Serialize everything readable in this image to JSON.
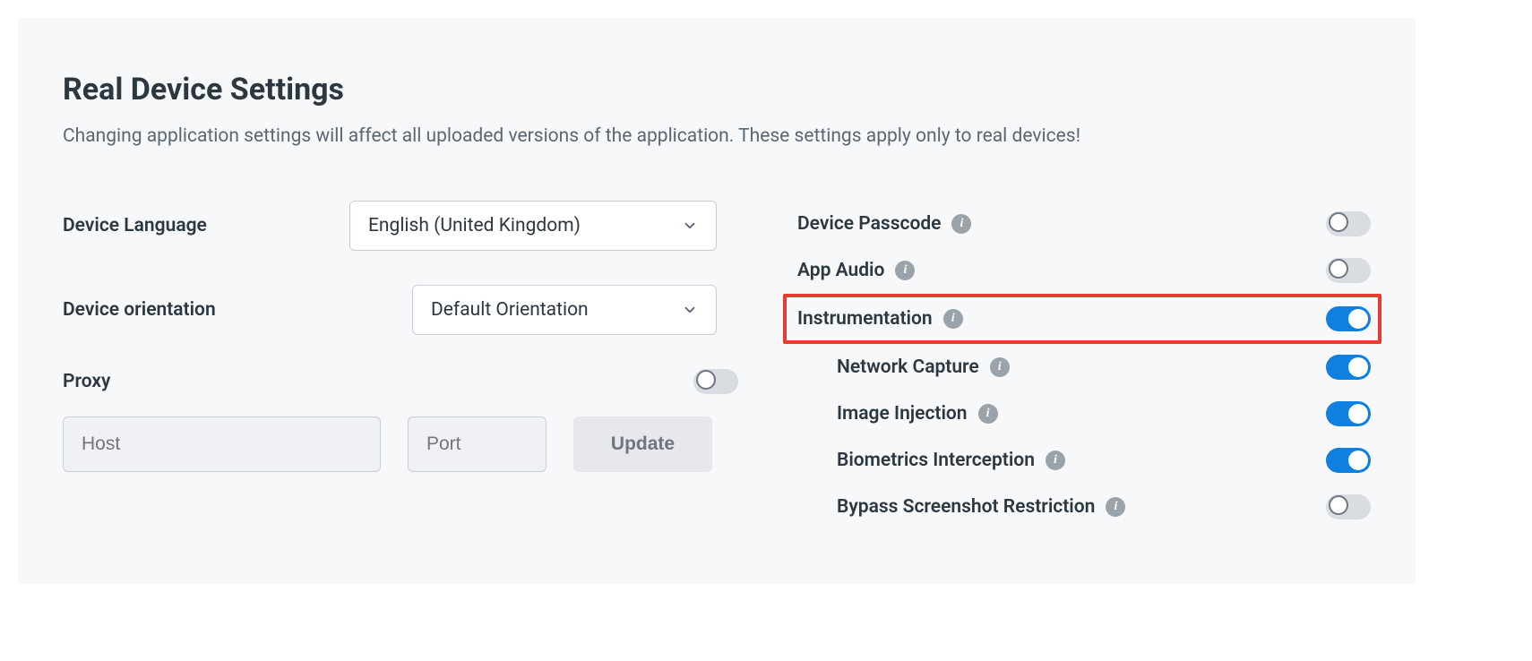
{
  "title": "Real Device Settings",
  "subtitle": "Changing application settings will affect all uploaded versions of the application. These settings apply only to real devices!",
  "left": {
    "language": {
      "label": "Device Language",
      "value": "English (United Kingdom)"
    },
    "orientation": {
      "label": "Device orientation",
      "value": "Default Orientation"
    },
    "proxy": {
      "label": "Proxy",
      "hostPlaceholder": "Host",
      "portPlaceholder": "Port",
      "updateLabel": "Update",
      "enabled": false
    }
  },
  "toggles": [
    {
      "label": "Device Passcode",
      "on": false,
      "indented": false,
      "highlighted": false
    },
    {
      "label": "App Audio",
      "on": false,
      "indented": false,
      "highlighted": false
    },
    {
      "label": "Instrumentation",
      "on": true,
      "indented": false,
      "highlighted": true
    },
    {
      "label": "Network Capture",
      "on": true,
      "indented": true,
      "highlighted": false
    },
    {
      "label": "Image Injection",
      "on": true,
      "indented": true,
      "highlighted": false
    },
    {
      "label": "Biometrics Interception",
      "on": true,
      "indented": true,
      "highlighted": false
    },
    {
      "label": "Bypass Screenshot Restriction",
      "on": false,
      "indented": true,
      "highlighted": false
    }
  ]
}
